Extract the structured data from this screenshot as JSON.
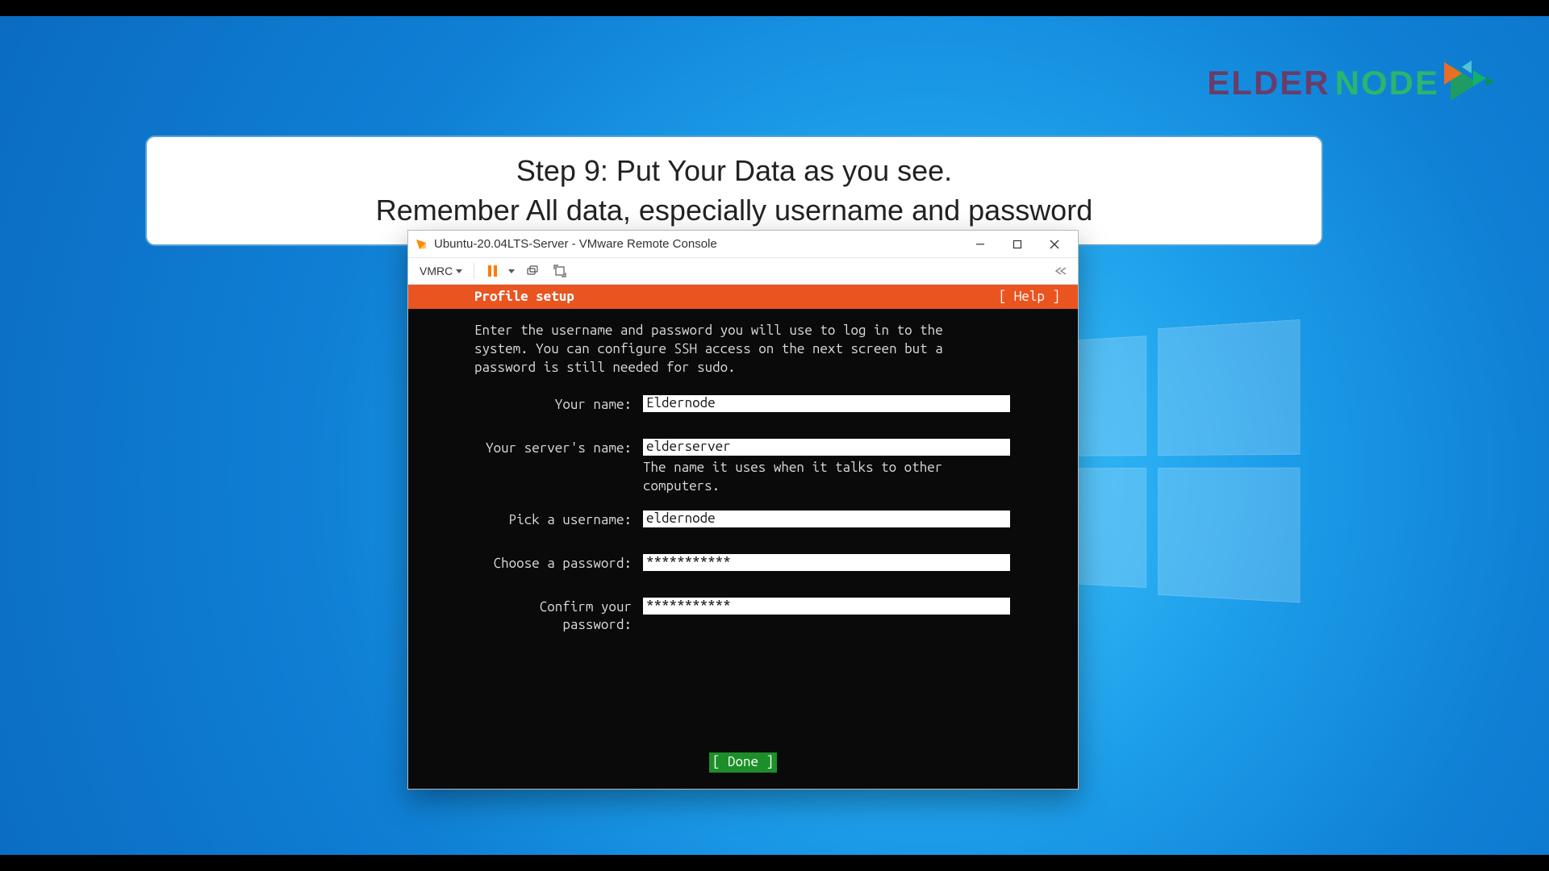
{
  "brand": {
    "elder": "ELDER",
    "node": "NODE"
  },
  "caption": {
    "line1": "Step 9: Put Your Data as you see.",
    "line2": "Remember All data, especially username and password"
  },
  "window": {
    "title": "Ubuntu-20.04LTS-Server - VMware Remote Console",
    "toolbar": {
      "vmrc": "VMRC"
    }
  },
  "installer": {
    "header_left": "Profile setup",
    "header_right": "[ Help ]",
    "description": "Enter the username and password you will use to log in to the system. You can configure SSH access on the next screen but a password is still needed for sudo.",
    "fields": {
      "name_label": "Your name:",
      "name_value": "Eldernode",
      "server_label": "Your server's name:",
      "server_value": "elderserver",
      "server_hint": "The name it uses when it talks to other computers.",
      "username_label": "Pick a username:",
      "username_value": "eldernode",
      "password_label": "Choose a password:",
      "password_value": "***********",
      "confirm_label": "Confirm your password:",
      "confirm_value": "***********"
    },
    "done": "[ Done        ]"
  }
}
